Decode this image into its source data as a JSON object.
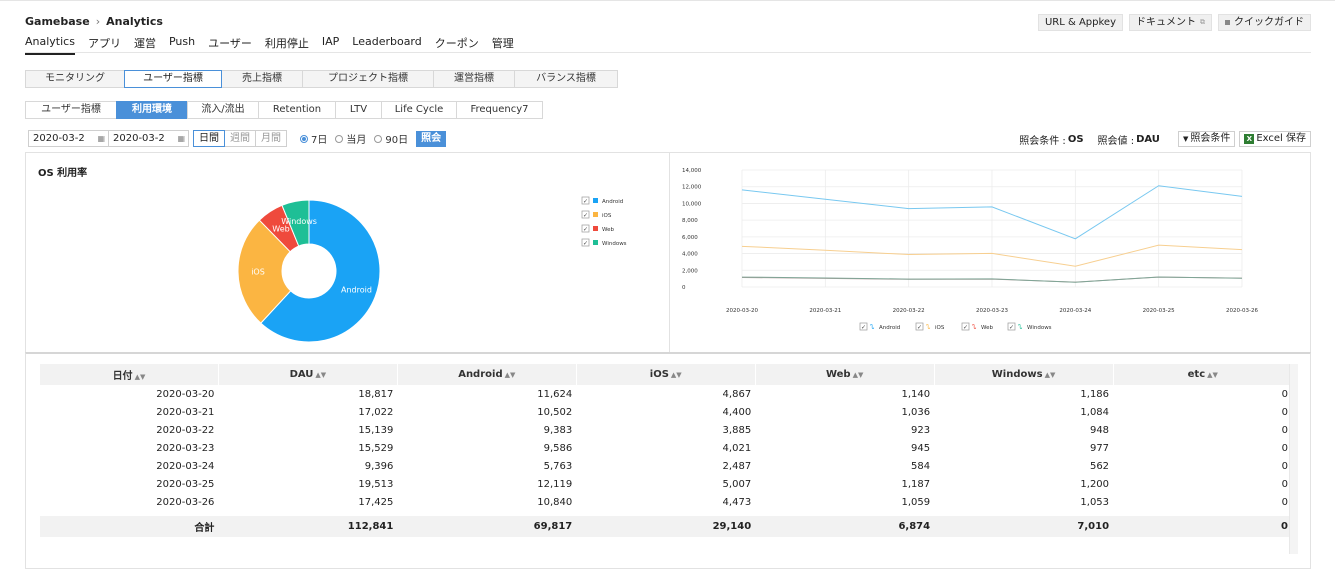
{
  "breadcrumb": {
    "root": "Gamebase",
    "sep": "›",
    "current": "Analytics"
  },
  "top_actions": {
    "url_appkey": "URL & Appkey",
    "docs": "ドキュメント",
    "quick_guide": "クイックガイド"
  },
  "main_nav": [
    "Analytics",
    "アプリ",
    "運営",
    "Push",
    "ユーザー",
    "利用停止",
    "IAP",
    "Leaderboard",
    "クーポン",
    "管理"
  ],
  "tabs_level1": [
    "モニタリング",
    "ユーザー指標",
    "売上指標",
    "プロジェクト指標",
    "運営指標",
    "バランス指標"
  ],
  "tabs_level2": [
    "ユーザー指標",
    "利用環境",
    "流入/流出",
    "Retention",
    "LTV",
    "Life Cycle",
    "Frequency7"
  ],
  "filters": {
    "start_date": "2020-03-2",
    "end_date": "2020-03-2",
    "granularity": [
      "日間",
      "週間",
      "月間"
    ],
    "ranges": [
      "7日",
      "当月",
      "90日"
    ],
    "query_button": "照会"
  },
  "conditions": {
    "query_condition_label": "照会条件 :",
    "query_condition_value": "OS",
    "query_value_label": "照会値 :",
    "query_value_value": "DAU",
    "filter_button": "照会条件",
    "excel_button": "Excel 保存"
  },
  "donut_title": "OS 利用率",
  "colors": {
    "Android": "#1aa3f5",
    "iOS": "#fbb542",
    "Web": "#ef4a3c",
    "Windows": "#1ebf96",
    "accent": "#4a90d9"
  },
  "chart_data": [
    {
      "type": "pie",
      "title": "OS 利用率",
      "donut": true,
      "categories": [
        "Android",
        "iOS",
        "Web",
        "Windows"
      ],
      "values": [
        69817,
        29140,
        6874,
        7010
      ],
      "legend_position": "right"
    },
    {
      "type": "line",
      "x": [
        "2020-03-20",
        "2020-03-21",
        "2020-03-22",
        "2020-03-23",
        "2020-03-24",
        "2020-03-25",
        "2020-03-26"
      ],
      "series": [
        {
          "name": "Android",
          "values": [
            11624,
            10502,
            9383,
            9586,
            5763,
            12119,
            10840
          ]
        },
        {
          "name": "iOS",
          "values": [
            4867,
            4400,
            3885,
            4021,
            2487,
            5007,
            4473
          ]
        },
        {
          "name": "Web",
          "values": [
            1140,
            1036,
            923,
            945,
            584,
            1187,
            1059
          ]
        },
        {
          "name": "Windows",
          "values": [
            1186,
            1084,
            948,
            977,
            562,
            1200,
            1053
          ]
        }
      ],
      "yticks": [
        "0",
        "2,000",
        "4,000",
        "6,000",
        "8,000",
        "10,000",
        "12,000",
        "14,000"
      ],
      "ylim": [
        0,
        14000
      ],
      "grid": true,
      "legend_position": "bottom"
    }
  ],
  "table": {
    "headers": [
      "日付",
      "DAU",
      "Android",
      "iOS",
      "Web",
      "Windows",
      "etc"
    ],
    "rows": [
      [
        "2020-03-20",
        "18,817",
        "11,624",
        "4,867",
        "1,140",
        "1,186",
        "0"
      ],
      [
        "2020-03-21",
        "17,022",
        "10,502",
        "4,400",
        "1,036",
        "1,084",
        "0"
      ],
      [
        "2020-03-22",
        "15,139",
        "9,383",
        "3,885",
        "923",
        "948",
        "0"
      ],
      [
        "2020-03-23",
        "15,529",
        "9,586",
        "4,021",
        "945",
        "977",
        "0"
      ],
      [
        "2020-03-24",
        "9,396",
        "5,763",
        "2,487",
        "584",
        "562",
        "0"
      ],
      [
        "2020-03-25",
        "19,513",
        "12,119",
        "5,007",
        "1,187",
        "1,200",
        "0"
      ],
      [
        "2020-03-26",
        "17,425",
        "10,840",
        "4,473",
        "1,059",
        "1,053",
        "0"
      ]
    ],
    "total": [
      "合計",
      "112,841",
      "69,817",
      "29,140",
      "6,874",
      "7,010",
      "0"
    ]
  }
}
